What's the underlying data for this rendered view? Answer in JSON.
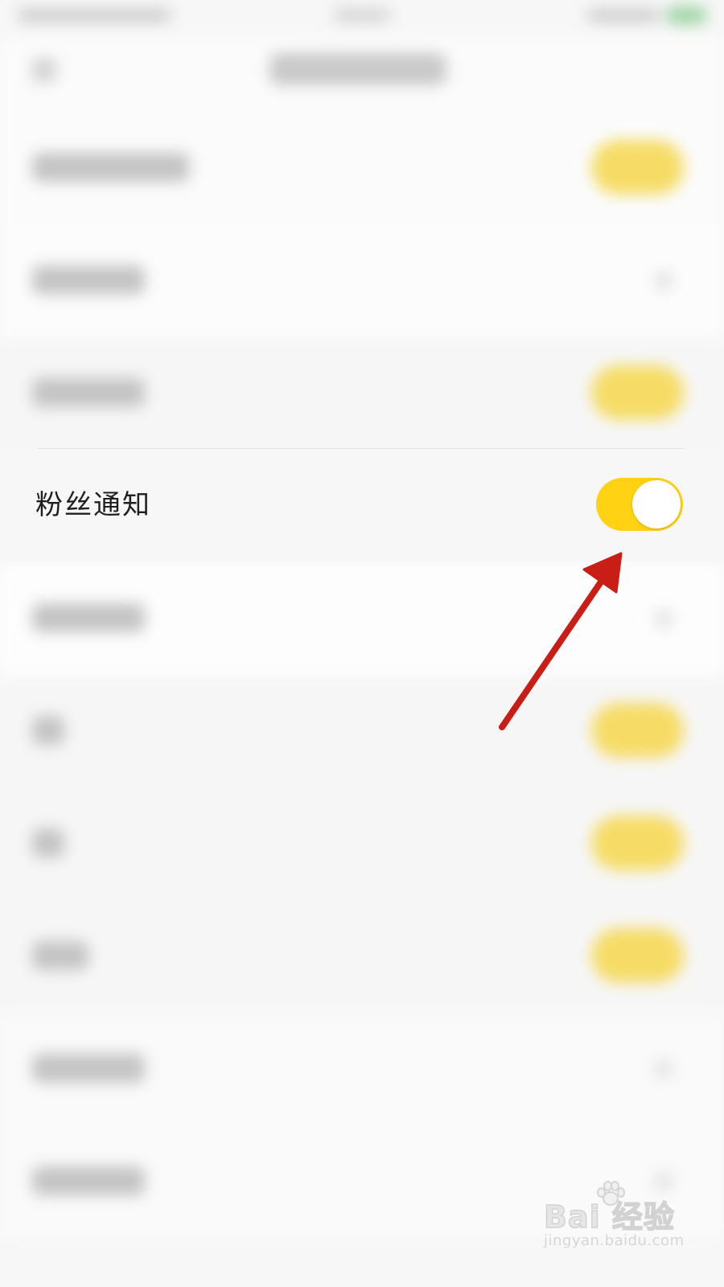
{
  "settings": {
    "rows": [
      {
        "name": "notification-row-1",
        "toggle_on": true
      },
      {
        "name": "notification-row-2",
        "toggle_on": false
      },
      {
        "name": "notification-row-3",
        "toggle_on": true
      },
      {
        "name": "fans-notification-row",
        "label": "粉丝通知",
        "toggle_on": true
      },
      {
        "name": "notification-row-5",
        "toggle_on": false
      },
      {
        "name": "notification-row-6",
        "toggle_on": true
      },
      {
        "name": "notification-row-7",
        "toggle_on": true
      },
      {
        "name": "notification-row-8",
        "toggle_on": true
      },
      {
        "name": "notification-row-9",
        "toggle_on": false
      },
      {
        "name": "notification-row-10",
        "toggle_on": false
      }
    ],
    "focused_row": {
      "label": "粉丝通知",
      "toggle_state": "on"
    }
  },
  "annotation": {
    "arrow_color": "#c81e16",
    "points_to": "fans-notification-toggle"
  },
  "watermark": {
    "logo_text": "Bai  经验",
    "url_text": "jingyan.baidu.com"
  },
  "colors": {
    "toggle_on": "#ffd313",
    "knob": "#ffffff",
    "background": "#f7f7f7"
  }
}
